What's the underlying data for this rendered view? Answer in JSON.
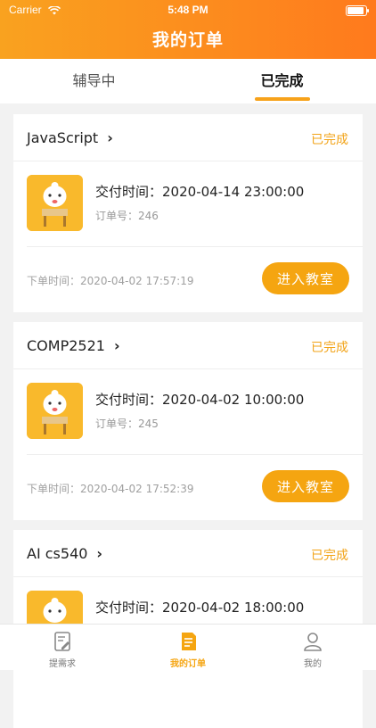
{
  "status_bar": {
    "carrier": "Carrier",
    "time": "5:48 PM"
  },
  "header": {
    "title": "我的订单"
  },
  "tabs": [
    {
      "label": "辅导中",
      "active": false
    },
    {
      "label": "已完成",
      "active": true
    }
  ],
  "orders": [
    {
      "course": "JavaScript",
      "status": "已完成",
      "delivery_label": "交付时间：",
      "delivery_time": "2020-04-14 23:00:00",
      "order_no_label": "订单号：",
      "order_no": "246",
      "placed_label": "下单时间：",
      "placed_time": "2020-04-02 17:57:19",
      "enter_label": "进入教室"
    },
    {
      "course": "COMP2521",
      "status": "已完成",
      "delivery_label": "交付时间：",
      "delivery_time": "2020-04-02 10:00:00",
      "order_no_label": "订单号：",
      "order_no": "245",
      "placed_label": "下单时间：",
      "placed_time": "2020-04-02 17:52:39",
      "enter_label": "进入教室"
    },
    {
      "course": "AI cs540",
      "status": "已完成",
      "delivery_label": "交付时间：",
      "delivery_time": "2020-04-02 18:00:00"
    }
  ],
  "tabbar": {
    "items": [
      {
        "label": "提需求",
        "icon": "edit-document-icon",
        "active": false
      },
      {
        "label": "我的订单",
        "icon": "order-list-icon",
        "active": true
      },
      {
        "label": "我的",
        "icon": "user-icon",
        "active": false
      }
    ]
  },
  "colors": {
    "accent": "#f5a511",
    "header_start": "#f9a21f",
    "header_end": "#ff7a1d"
  }
}
